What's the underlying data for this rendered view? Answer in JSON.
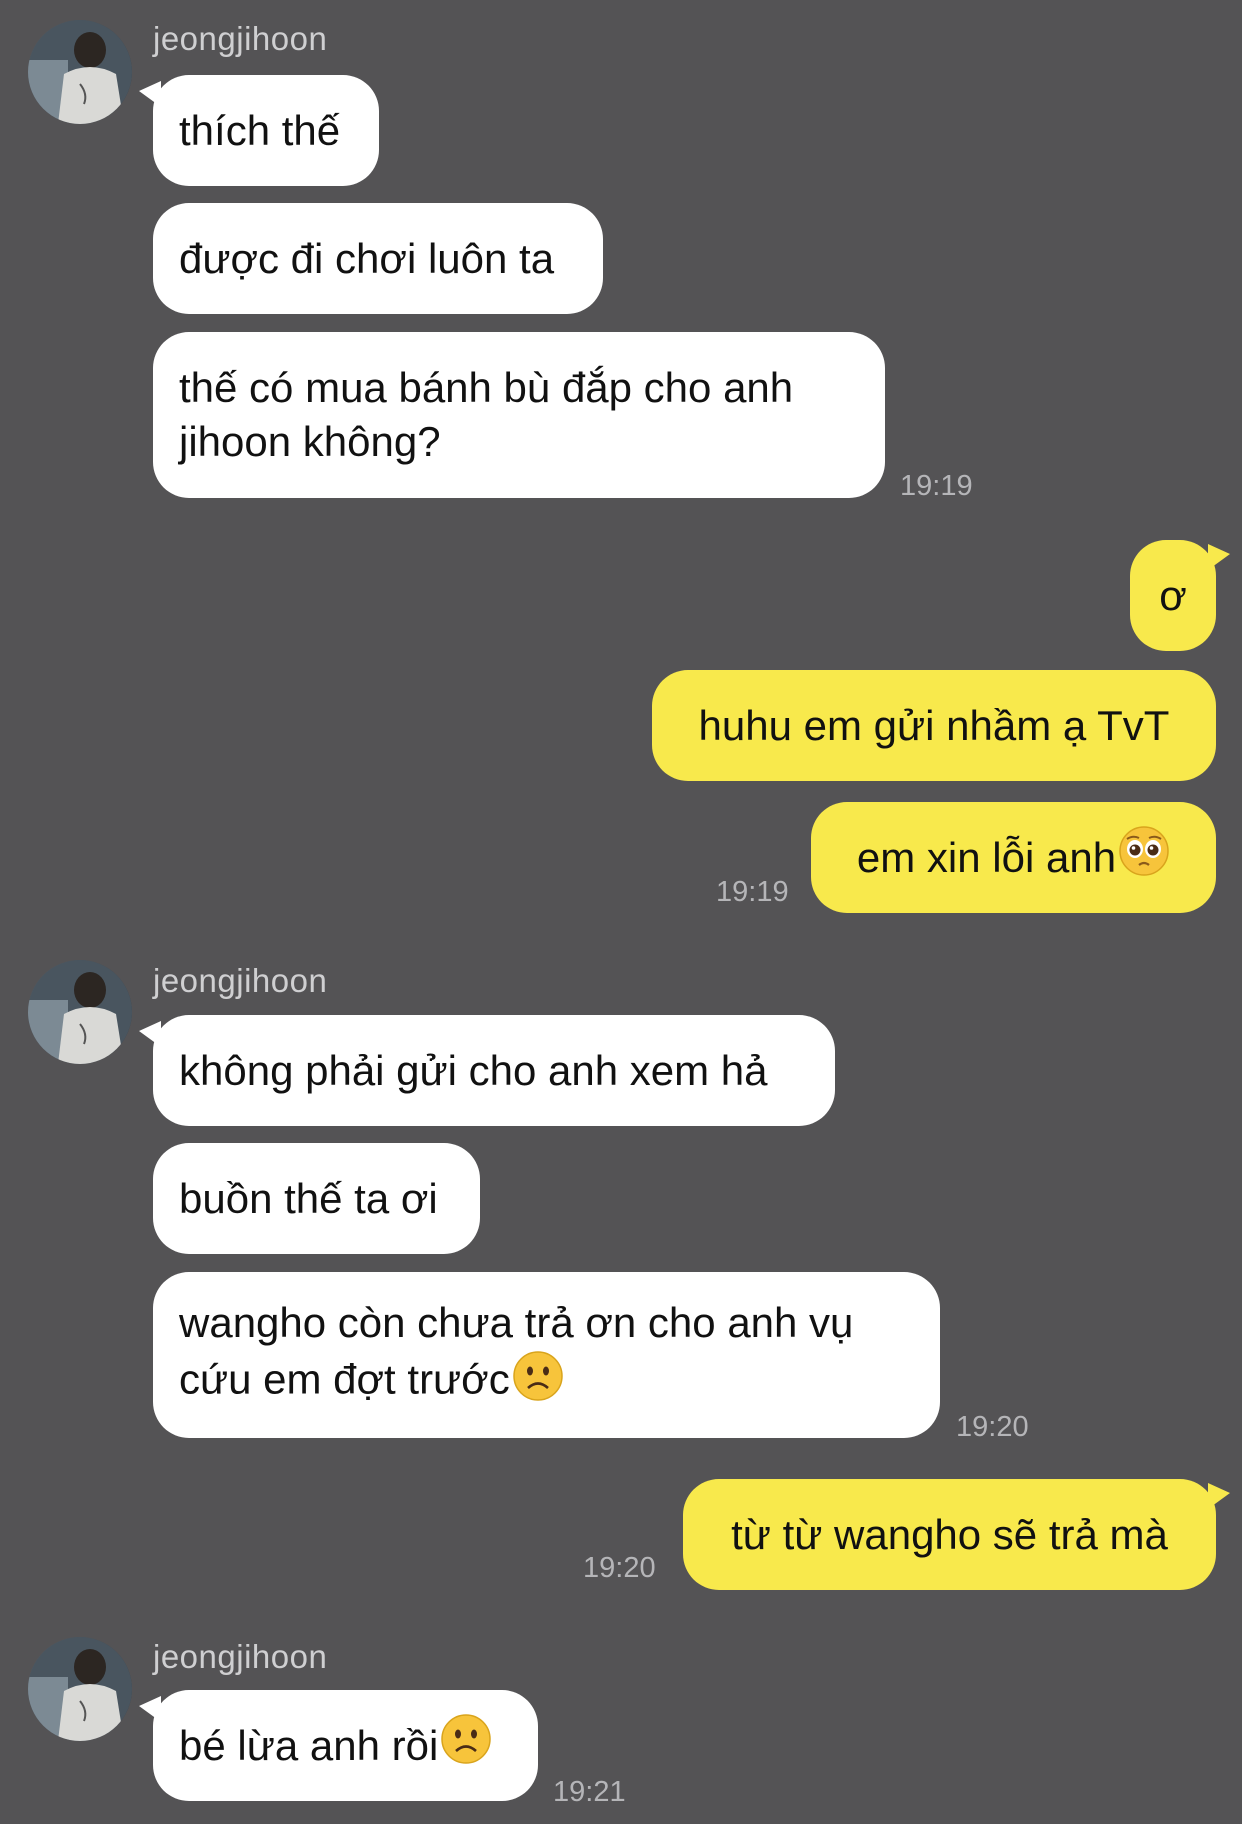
{
  "chat": {
    "contact_name": "jeongjihoon",
    "colors": {
      "background": "#545355",
      "incoming_bubble": "#ffffff",
      "outgoing_bubble": "#f8e94c",
      "timestamp": "#b5b5b8"
    },
    "groups": [
      {
        "sender": "jeongjihoon",
        "direction": "incoming",
        "messages": [
          "thích thế",
          "được đi chơi luôn ta",
          "thế có mua bánh bù đắp cho anh jihoon không?"
        ],
        "time": "19:19"
      },
      {
        "direction": "outgoing",
        "messages": [
          "ơ",
          "huhu em gửi nhầm ạ TvT",
          "em xin lỗi anh"
        ],
        "emoji": "pleading-face",
        "time": "19:19"
      },
      {
        "sender": "jeongjihoon",
        "direction": "incoming",
        "messages": [
          "không phải gửi cho anh xem hả",
          "buồn thế ta ơi",
          "wangho còn chưa trả ơn cho anh vụ cứu em đợt trước"
        ],
        "emoji": "frowning-face",
        "time": "19:20"
      },
      {
        "direction": "outgoing",
        "messages": [
          "từ từ wangho sẽ trả mà"
        ],
        "time": "19:20"
      },
      {
        "sender": "jeongjihoon",
        "direction": "incoming",
        "messages": [
          "bé lừa anh rồi"
        ],
        "emoji": "frowning-face",
        "time": "19:21"
      }
    ]
  }
}
